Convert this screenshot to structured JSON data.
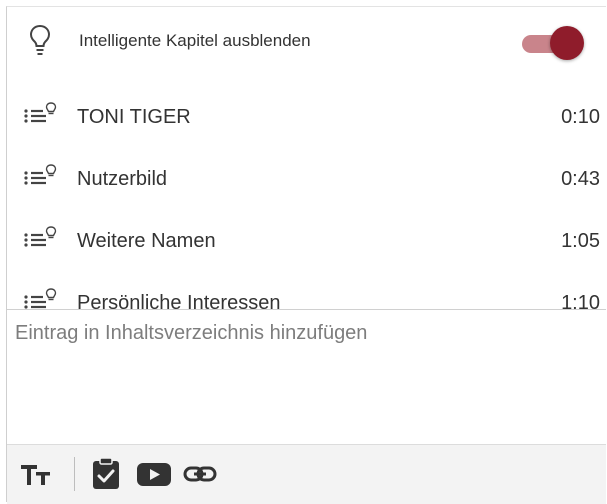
{
  "header": {
    "label": "Intelligente Kapitel ausblenden",
    "toggle_on": true,
    "accent_color": "#8f1c2b"
  },
  "chapters": [
    {
      "title": "TONI TIGER",
      "time": "0:10"
    },
    {
      "title": "Nutzerbild",
      "time": "0:43"
    },
    {
      "title": "Weitere Namen",
      "time": "1:05"
    },
    {
      "title": "Persönliche Interessen",
      "time": "1:10"
    }
  ],
  "editor": {
    "placeholder": "Eintrag in Inhaltsverzeichnis hinzufügen",
    "value": ""
  },
  "toolbar": {
    "items": [
      "text-format-icon",
      "clipboard-check-icon",
      "video-play-icon",
      "link-icon"
    ]
  }
}
